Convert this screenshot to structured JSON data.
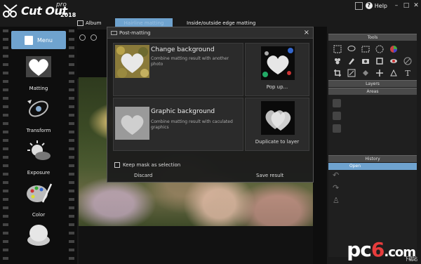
{
  "app": {
    "brand": "Cut Out",
    "edition": "pro",
    "year": "2018"
  },
  "window": {
    "help_label": "Help",
    "min_label": "–",
    "max_label": "□",
    "close_label": "✕"
  },
  "tabs": [
    {
      "label": "Album"
    },
    {
      "label": "Hairline matting"
    },
    {
      "label": "Inside/outside edge matting"
    }
  ],
  "sidebar": {
    "menu_label": "Menu",
    "items": [
      {
        "label": "Matting",
        "icon": "heart-icon"
      },
      {
        "label": "Transform",
        "icon": "transform-icon"
      },
      {
        "label": "Exposure",
        "icon": "exposure-icon"
      },
      {
        "label": "Color",
        "icon": "palette-icon"
      },
      {
        "label": "",
        "icon": "compact-icon"
      }
    ]
  },
  "dialog": {
    "title": "Post-matting",
    "close_label": "×",
    "options": [
      {
        "title": "Change background",
        "desc": "Combine matting result with another photo",
        "action": "Pop up..."
      },
      {
        "title": "Graphic background",
        "desc": "Combine matting result with caculated graphics",
        "action": "Duplicate to layer"
      }
    ],
    "keep_mask_label": "Keep mask as selection",
    "discard_label": "Discard",
    "save_label": "Save result"
  },
  "right_panel": {
    "tools_header": "Tools",
    "layers_header": "Layers",
    "areas_header": "Areas",
    "history_header": "History",
    "history_items": [
      "Open"
    ],
    "text_tool_glyph": "T"
  },
  "watermark": {
    "text_p": "pc",
    "text_six": "6",
    "text_com": ".com",
    "sub": "下载站"
  }
}
